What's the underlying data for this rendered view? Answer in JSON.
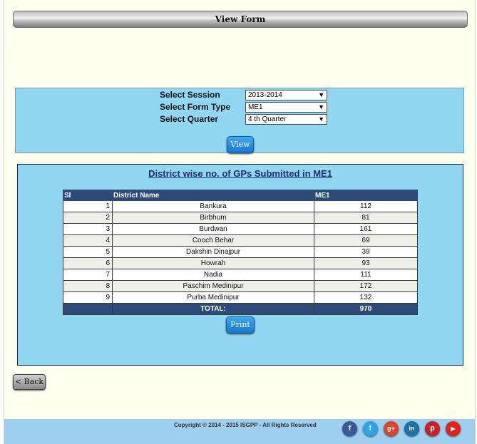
{
  "title": "View Form",
  "filters": [
    {
      "label": "Select Session",
      "value": "2013-2014"
    },
    {
      "label": "Select Form Type",
      "value": "ME1"
    },
    {
      "label": "Select Quarter",
      "value": "4 th Quarter"
    }
  ],
  "view_button": "View",
  "report": {
    "title": "District wise no. of GPs Submitted in ME1",
    "columns": [
      "Sl",
      "District Name",
      "ME1"
    ],
    "rows": [
      {
        "sl": "1",
        "district": "Bankura",
        "value": "112"
      },
      {
        "sl": "2",
        "district": "Birbhum",
        "value": "81"
      },
      {
        "sl": "3",
        "district": "Burdwan",
        "value": "161"
      },
      {
        "sl": "4",
        "district": "Cooch Behar",
        "value": "69"
      },
      {
        "sl": "5",
        "district": "Dakshin Dinajpur",
        "value": "39"
      },
      {
        "sl": "6",
        "district": "Howrah",
        "value": "93"
      },
      {
        "sl": "7",
        "district": "Nadia",
        "value": "111"
      },
      {
        "sl": "8",
        "district": "Paschim Medinipur",
        "value": "172"
      },
      {
        "sl": "9",
        "district": "Purba Medinipur",
        "value": "132"
      }
    ],
    "total_label": "TOTAL:",
    "total_value": "970"
  },
  "print_button": "Print",
  "back_button": "< Back",
  "footer": {
    "copyright": "Copyright © 2014 - 2015 ISGPP - All Rights Reserved",
    "social": [
      "facebook-icon",
      "twitter-icon",
      "google-plus-icon",
      "linkedin-icon",
      "pinterest-icon",
      "youtube-icon"
    ]
  }
}
